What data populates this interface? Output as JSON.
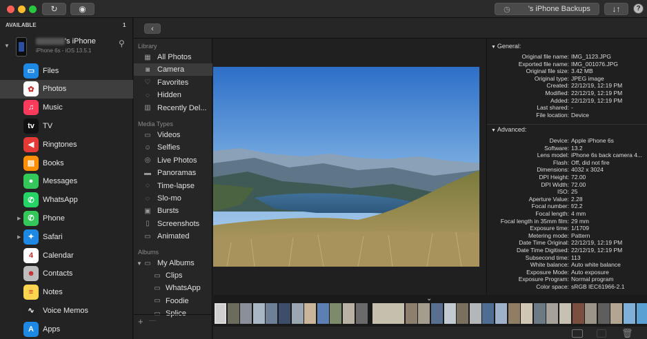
{
  "toolbar": {
    "backups_label": "'s iPhone Backups",
    "refresh_icon": "refresh-icon",
    "eye_icon": "eye-icon",
    "transfer_icon": "transfer-icon",
    "help_label": "?"
  },
  "device": {
    "available_label": "AVAILABLE",
    "available_count": "1",
    "name": "'s iPhone",
    "model": "iPhone 6s - iOS 13.5.1"
  },
  "apps": [
    {
      "label": "Files",
      "icon": "files-icon",
      "color": "#1e88e5",
      "glyph": "▭"
    },
    {
      "label": "Photos",
      "icon": "photos-icon",
      "color": "#ffffff",
      "glyph": "✿"
    },
    {
      "label": "Music",
      "icon": "music-icon",
      "color": "#ff3b5c",
      "glyph": "♫"
    },
    {
      "label": "TV",
      "icon": "tv-icon",
      "color": "#111111",
      "glyph": "tv"
    },
    {
      "label": "Ringtones",
      "icon": "ringtones-icon",
      "color": "#e53935",
      "glyph": "◀"
    },
    {
      "label": "Books",
      "icon": "books-icon",
      "color": "#ff8f00",
      "glyph": "▤"
    },
    {
      "label": "Messages",
      "icon": "messages-icon",
      "color": "#34c759",
      "glyph": "●"
    },
    {
      "label": "WhatsApp",
      "icon": "whatsapp-icon",
      "color": "#25d366",
      "glyph": "✆"
    },
    {
      "label": "Phone",
      "icon": "phone-icon",
      "color": "#34c759",
      "glyph": "✆"
    },
    {
      "label": "Safari",
      "icon": "safari-icon",
      "color": "#1e88e5",
      "glyph": "✦"
    },
    {
      "label": "Calendar",
      "icon": "calendar-icon",
      "color": "#ffffff",
      "glyph": "4"
    },
    {
      "label": "Contacts",
      "icon": "contacts-icon",
      "color": "#bdbdbd",
      "glyph": "☻"
    },
    {
      "label": "Notes",
      "icon": "notes-icon",
      "color": "#ffd54f",
      "glyph": "≡"
    },
    {
      "label": "Voice Memos",
      "icon": "voice-memos-icon",
      "color": "#222222",
      "glyph": "∿"
    },
    {
      "label": "Apps",
      "icon": "apps-icon",
      "color": "#1e88e5",
      "glyph": "A"
    }
  ],
  "library": {
    "section_library": "Library",
    "items": [
      {
        "label": "All Photos",
        "icon": "all-photos-icon",
        "glyph": "▦"
      },
      {
        "label": "Camera",
        "icon": "camera-icon",
        "glyph": "◙"
      },
      {
        "label": "Favorites",
        "icon": "heart-icon",
        "glyph": "♡"
      },
      {
        "label": "Hidden",
        "icon": "hidden-icon",
        "glyph": "◌"
      },
      {
        "label": "Recently Del...",
        "icon": "trash-icon",
        "glyph": "▥"
      }
    ],
    "section_media": "Media Types",
    "media": [
      {
        "label": "Videos",
        "icon": "videos-icon",
        "glyph": "▭"
      },
      {
        "label": "Selfies",
        "icon": "selfies-icon",
        "glyph": "☺"
      },
      {
        "label": "Live Photos",
        "icon": "live-photos-icon",
        "glyph": "◎"
      },
      {
        "label": "Panoramas",
        "icon": "panoramas-icon",
        "glyph": "▬"
      },
      {
        "label": "Time-lapse",
        "icon": "time-lapse-icon",
        "glyph": "◌"
      },
      {
        "label": "Slo-mo",
        "icon": "slo-mo-icon",
        "glyph": "◌"
      },
      {
        "label": "Bursts",
        "icon": "bursts-icon",
        "glyph": "▣"
      },
      {
        "label": "Screenshots",
        "icon": "screenshots-icon",
        "glyph": "▯"
      },
      {
        "label": "Animated",
        "icon": "animated-icon",
        "glyph": "▭"
      }
    ],
    "section_albums": "Albums",
    "my_albums": "My Albums",
    "albums": [
      {
        "label": "Clips"
      },
      {
        "label": "WhatsApp"
      },
      {
        "label": "Foodie"
      },
      {
        "label": "Splice"
      }
    ],
    "add_label": "+",
    "remove_label": "—"
  },
  "info": {
    "general_label": "General:",
    "general": [
      {
        "k": "Original file name:",
        "v": "IMG_1123.JPG"
      },
      {
        "k": "Exported file name:",
        "v": "IMG_001076.JPG"
      },
      {
        "k": "Original file size:",
        "v": "3.42 MB"
      },
      {
        "k": "Original type:",
        "v": "JPEG image"
      },
      {
        "k": "Created:",
        "v": "22/12/19, 12:19 PM"
      },
      {
        "k": "Modified:",
        "v": "22/12/19, 12:19 PM"
      },
      {
        "k": "Added:",
        "v": "22/12/19, 12:19 PM"
      },
      {
        "k": "Last shared:",
        "v": "-"
      },
      {
        "k": "File location:",
        "v": "Device"
      }
    ],
    "advanced_label": "Advanced:",
    "advanced": [
      {
        "k": "Device:",
        "v": "Apple iPhone 6s"
      },
      {
        "k": "Software:",
        "v": "13.2"
      },
      {
        "k": "Lens model:",
        "v": "iPhone 6s back camera 4..."
      },
      {
        "k": "Flash:",
        "v": "Off, did not fire"
      },
      {
        "k": "Dimensions:",
        "v": "4032 x 3024"
      },
      {
        "k": "DPI Height:",
        "v": "72.00"
      },
      {
        "k": "DPI Width:",
        "v": "72.00"
      },
      {
        "k": "ISO:",
        "v": "25"
      },
      {
        "k": "Aperture Value:",
        "v": "2.28"
      },
      {
        "k": "Focal number:",
        "v": "f/2.2"
      },
      {
        "k": "Focal length:",
        "v": "4 mm"
      },
      {
        "k": "Focal length in 35mm film:",
        "v": "29 mm"
      },
      {
        "k": "Exposure time:",
        "v": "1/1709"
      },
      {
        "k": "Metering mode:",
        "v": "Pattern"
      },
      {
        "k": "Date Time Original:",
        "v": "22/12/19, 12:19 PM"
      },
      {
        "k": "Date Time Digitised:",
        "v": "22/12/19, 12:19 PM"
      },
      {
        "k": "Subsecond time:",
        "v": "113"
      },
      {
        "k": "White balance:",
        "v": "Auto white balance"
      },
      {
        "k": "Exposure Mode:",
        "v": "Auto exposure"
      },
      {
        "k": "Exposure Program:",
        "v": "Normal program"
      },
      {
        "k": "Color space:",
        "v": "sRGB IEC61966-2.1"
      }
    ]
  }
}
